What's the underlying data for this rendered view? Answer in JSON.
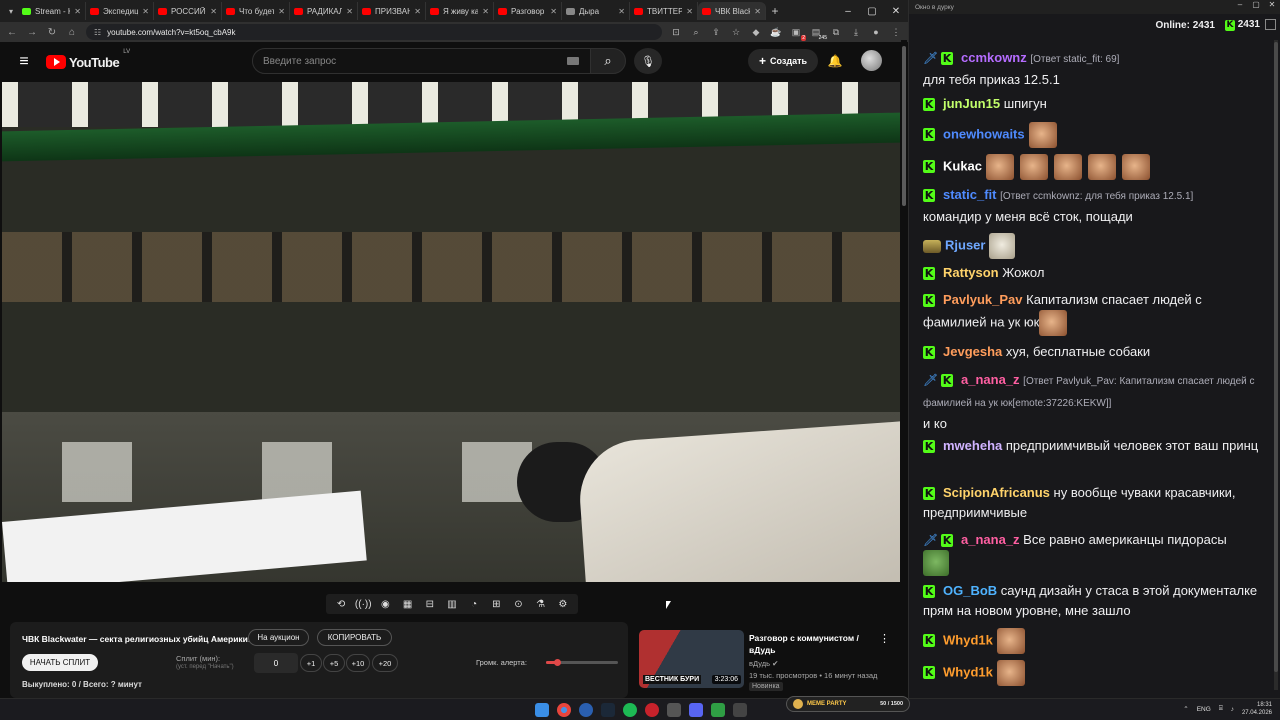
{
  "browser": {
    "tabs": [
      {
        "title": "Stream - Kick",
        "color": "#53fc18"
      },
      {
        "title": "Экспедиция",
        "color": "#ff0000"
      },
      {
        "title": "РОССИЙСКИЕ",
        "color": "#ff0000"
      },
      {
        "title": "Что будет",
        "color": "#ff0000"
      },
      {
        "title": "РАДИКАЛЬНЫЙ",
        "color": "#ff0000"
      },
      {
        "title": "ПРИЗВАНИЕ",
        "color": "#ff0000"
      },
      {
        "title": "Я живу как",
        "color": "#ff0000"
      },
      {
        "title": "Разговор с",
        "color": "#ff0000"
      },
      {
        "title": "Дыра",
        "color": "#888888"
      },
      {
        "title": "ТВИТТЕР СН",
        "color": "#ff0000"
      },
      {
        "title": "ЧВК Blackw",
        "color": "#ff0000",
        "active": true
      }
    ],
    "url": "youtube.com/watch?v=kt5oq_cbA9k",
    "ext_badge_1": "2",
    "ext_badge_2": "245"
  },
  "youtube": {
    "logo_text": "YouTube",
    "logo_region": "LV",
    "search_placeholder": "Введите запрос",
    "create_label": "Создать"
  },
  "split_panel": {
    "title": "ЧВК Blackwater — секта религиозных убийц Америки!",
    "auction_btn": "На аукцион",
    "copy_btn": "КОПИРОВАТЬ",
    "start_split_btn": "НАЧАТЬ СПЛИТ",
    "split_label": "Сплит (мин):",
    "split_hint": "(уст. перед \"Начать\")",
    "split_value": "0",
    "inc_1": "+1",
    "inc_5": "+5",
    "inc_10": "+10",
    "inc_20": "+20",
    "volume_label": "Громк. алерта:",
    "volume_level": 0.15,
    "footer": "Выкуплено: 0 / Всего: ? минут"
  },
  "recommended": {
    "title": "Разговор с коммунистом / вДудь",
    "channel": "вДудь",
    "meta": "19 тыс. просмотров • 16 минут назад",
    "badge": "Новинка",
    "duration": "3:23:06",
    "thumb_caption": "ВЕСТНИК БУРИ"
  },
  "chat": {
    "window_title": "Окно в дурку",
    "online_label": "Online:",
    "online_count": "2431",
    "kick_count": "2431",
    "messages": [
      {
        "user": "ccmkownz",
        "color": "#b56cff",
        "badges": [
          "sword",
          "kick"
        ],
        "reply": "[Ответ static_fit: 69]",
        "text": "для тебя приказ 12.5.1"
      },
      {
        "user": "junJun15",
        "color": "#c2ff6b",
        "badges": [
          "kick"
        ],
        "text": "шпигун"
      },
      {
        "user": "onewhowaits",
        "color": "#4f8bff",
        "badges": [
          "kick"
        ],
        "text": ""
      },
      {
        "user": "Kukac",
        "color": "#ffffff",
        "badges": [
          "kick"
        ],
        "text": ""
      },
      {
        "user": "static_fit",
        "color": "#4f8bff",
        "badges": [
          "kick"
        ],
        "reply": "[Ответ ccmkownz: для тебя приказ 12.5.1]",
        "text": "командир у меня всё сток, пощади"
      },
      {
        "user": "Rjuser",
        "color": "#6fa8ff",
        "badges": [
          "hat"
        ],
        "text": ""
      },
      {
        "user": "Rattyson",
        "color": "#ffd36b",
        "badges": [
          "kick"
        ],
        "text": "Жожол"
      },
      {
        "user": "Pavlyuk_Pav",
        "color": "#ff9d5c",
        "badges": [
          "kick"
        ],
        "text": "Капитализм спасает людей с фамилией на ук юк"
      },
      {
        "user": "Jevgesha",
        "color": "#ff9d5c",
        "badges": [
          "kick"
        ],
        "text": "хуя, бесплатные собаки"
      },
      {
        "user": "a_nana_z",
        "color": "#ff5fa2",
        "badges": [
          "sword",
          "kick"
        ],
        "reply": "[Ответ Pavlyuk_Pav: Капитализм спасает людей с фамилией на ук юк[emote:37226:KEKW]]",
        "text": "и ко"
      },
      {
        "user": "mweheha",
        "color": "#d0b3ff",
        "badges": [
          "kick"
        ],
        "text": "предприимчивый человек этот ваш принц"
      },
      {
        "user": "ScipionAfricanus",
        "color": "#ffd36b",
        "badges": [
          "kick"
        ],
        "text": "ну вообще чуваки красавчики, предприимчивые"
      },
      {
        "user": "a_nana_z",
        "color": "#ff5fa2",
        "badges": [
          "sword",
          "kick"
        ],
        "text": "Все равно американцы пидорасы"
      },
      {
        "user": "OG_BoB",
        "color": "#4fb3ff",
        "badges": [
          "kick"
        ],
        "text": "саунд дизайн у стаса в этой документалке прям на новом уровне, мне зашло"
      },
      {
        "user": "Whyd1k",
        "color": "#ff9d2e",
        "badges": [
          "kick"
        ],
        "text": ""
      },
      {
        "user": "Whyd1k",
        "color": "#ff9d2e",
        "badges": [
          "kick"
        ],
        "text": ""
      }
    ]
  },
  "taskbar": {
    "meme_label": "MEME PARTY",
    "meme_count": "50 / 1500",
    "lang": "ENG",
    "time": "18:31",
    "date": "27.04.2026"
  }
}
